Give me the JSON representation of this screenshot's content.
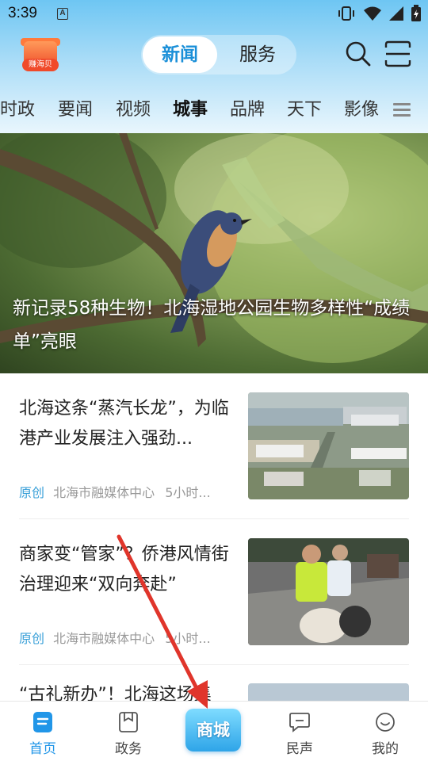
{
  "status_bar": {
    "time": "3:39",
    "notification_badge": "A"
  },
  "header": {
    "logo_label": "赚海贝",
    "segments": [
      "新闻",
      "服务"
    ],
    "active_segment": "新闻"
  },
  "categories": [
    "时政",
    "要闻",
    "视频",
    "城事",
    "品牌",
    "天下",
    "影像"
  ],
  "active_category": "城事",
  "hero": {
    "title": "新记录58种生物！北海湿地公园生物多样性“成绩单”亮眼"
  },
  "news": [
    {
      "title": "北海这条“蒸汽长龙”，为临港产业发展注入强劲...",
      "tag": "原创",
      "source": "北海市融媒体中心",
      "time": "5小时..."
    },
    {
      "title": "商家变“管家”？侨港风情街治理迎来“双向奔赴”",
      "tag": "原创",
      "source": "北海市融媒体中心",
      "time": "5小时..."
    },
    {
      "title": "“古礼新办”！北海这场集"
    }
  ],
  "tabs": [
    {
      "label": "首页",
      "icon": "home-icon",
      "active": true
    },
    {
      "label": "政务",
      "icon": "bookmark-icon",
      "active": false
    },
    {
      "label": "商城",
      "icon": "mall-icon",
      "active": false
    },
    {
      "label": "民声",
      "icon": "chat-icon",
      "active": false
    },
    {
      "label": "我的",
      "icon": "profile-icon",
      "active": false
    }
  ],
  "colors": {
    "accent": "#2196e8",
    "tag": "#3aa0d8",
    "annotation_arrow": "#e0352b"
  }
}
